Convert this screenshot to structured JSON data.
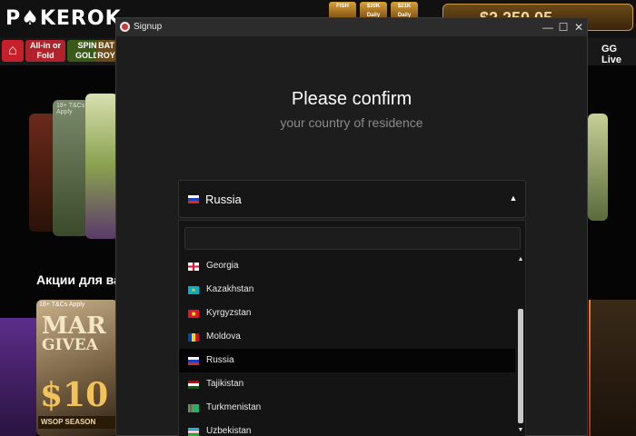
{
  "background": {
    "logo_text": "P♠KEROK",
    "top_badges": [
      "FISH",
      "$30K Daily",
      "$21K Daily"
    ],
    "balance_text": "$2,250,05",
    "nav_tiles": [
      {
        "label": "All-in or Fold",
        "color": "#b3212a"
      },
      {
        "label": "SPIN GOLD",
        "color": "#3a5a1a"
      },
      {
        "label": "BAT ROY",
        "color": "#6a4a1a"
      }
    ],
    "gg_live_label": "GG Live",
    "tnc_label": "18+ T&Cs Apply",
    "promo_heading": "Акции для ва",
    "promo_card": {
      "tnc": "18+ T&Cs Apply",
      "line1": "MAR",
      "line2": "GIVEA",
      "line3": "$10",
      "footer": "WSOP SEASON"
    }
  },
  "window": {
    "title": "Signup",
    "minimize_icon": "minimize-icon",
    "maximize_icon": "maximize-icon",
    "close_icon": "close-icon"
  },
  "modal": {
    "title": "Please confirm",
    "subtitle": "your country of residence"
  },
  "country_select": {
    "selected_label": "Russia",
    "selected_flag": "russia-flag",
    "caret_icon": "caret-up-icon"
  },
  "dropdown": {
    "search_value": "",
    "items": [
      {
        "label": "Georgia",
        "flag": "georgia-flag",
        "selected": false
      },
      {
        "label": "Kazakhstan",
        "flag": "kazakhstan-flag",
        "selected": false
      },
      {
        "label": "Kyrgyzstan",
        "flag": "kyrgyzstan-flag",
        "selected": false
      },
      {
        "label": "Moldova",
        "flag": "moldova-flag",
        "selected": false
      },
      {
        "label": "Russia",
        "flag": "russia-flag",
        "selected": true
      },
      {
        "label": "Tajikistan",
        "flag": "tajikistan-flag",
        "selected": false
      },
      {
        "label": "Turkmenistan",
        "flag": "turkmenistan-flag",
        "selected": false
      },
      {
        "label": "Uzbekistan",
        "flag": "uzbekistan-flag",
        "selected": false
      }
    ]
  },
  "colors": {
    "modal_bg": "#1d1d1d",
    "selected_row_bg": "#050505",
    "text_primary": "#ffffff",
    "text_muted": "#8a8a8a"
  }
}
